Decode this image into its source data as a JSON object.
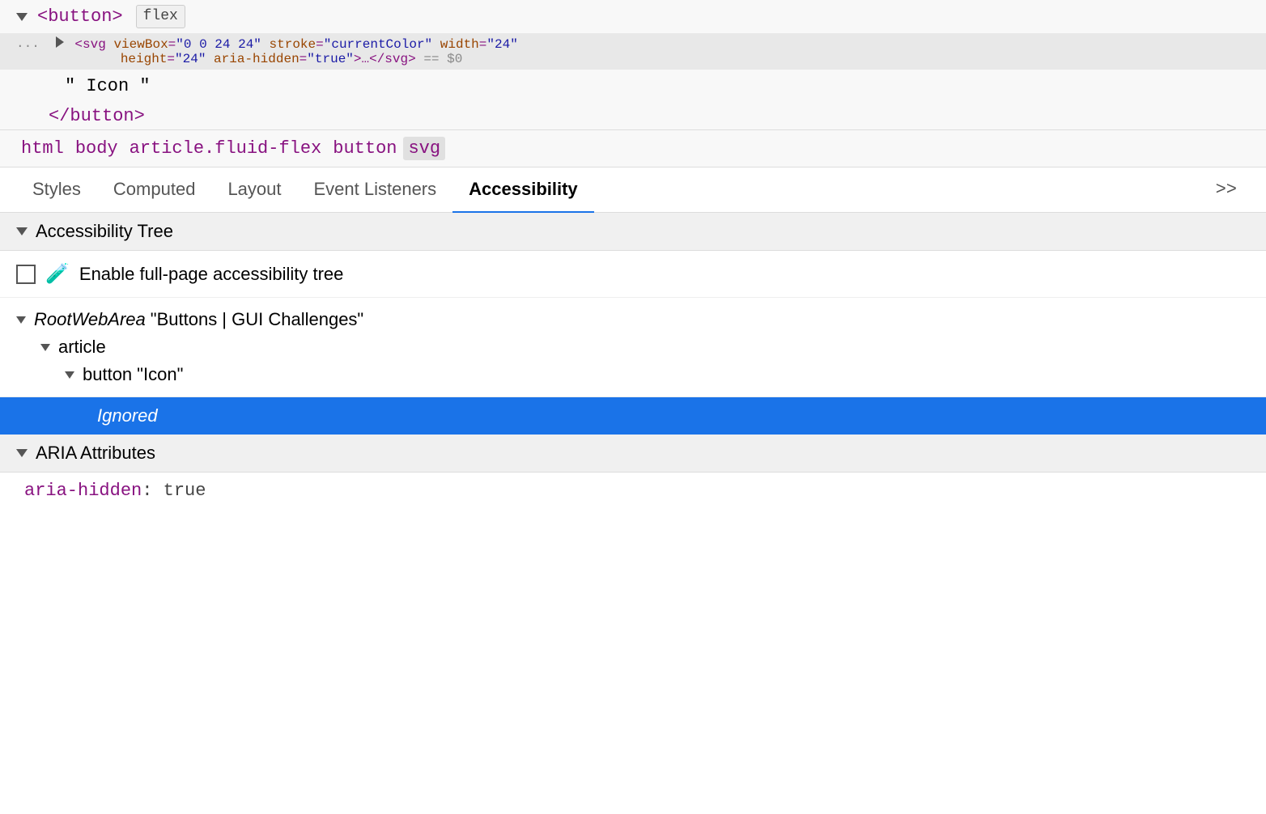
{
  "dom": {
    "button_open": "<button>",
    "flex_badge": "flex",
    "svg_dots": "...",
    "svg_line1": "<svg viewBox=\"0 0 24 24\" stroke=\"currentColor\" width=\"24\"",
    "svg_attr_viewbox_name": "viewBox",
    "svg_attr_viewbox_value": "\"0 0 24 24\"",
    "svg_attr_stroke_name": "stroke",
    "svg_attr_stroke_value": "\"currentColor\"",
    "svg_attr_width_name": "width",
    "svg_attr_width_value": "\"24\"",
    "svg_line2_attr_height_name": "height",
    "svg_line2_attr_height_value": "\"24\"",
    "svg_line2_attr_aria_name": "aria-hidden",
    "svg_line2_attr_aria_value": "\"true\"",
    "svg_line2_close": ">…</svg>",
    "svg_dollar": "== $0",
    "text_content": "\" Icon \"",
    "button_close": "</button>"
  },
  "breadcrumb": {
    "items": [
      {
        "label": "html",
        "active": false
      },
      {
        "label": "body",
        "active": false
      },
      {
        "label": "article.fluid-flex",
        "active": false
      },
      {
        "label": "button",
        "active": false
      },
      {
        "label": "svg",
        "active": true
      }
    ]
  },
  "tabs": {
    "items": [
      {
        "label": "Styles",
        "active": false
      },
      {
        "label": "Computed",
        "active": false
      },
      {
        "label": "Layout",
        "active": false
      },
      {
        "label": "Event Listeners",
        "active": false
      },
      {
        "label": "Accessibility",
        "active": true
      }
    ],
    "more_label": ">>"
  },
  "accessibility": {
    "tree_section_title": "Accessibility Tree",
    "enable_checkbox_label": "Enable full-page accessibility tree",
    "tree": {
      "root_label": "RootWebArea",
      "root_value": "\"Buttons | GUI Challenges\"",
      "article_label": "article",
      "button_label": "button",
      "button_value": "\"Icon\"",
      "ignored_label": "Ignored"
    },
    "aria_section_title": "ARIA Attributes",
    "aria_attributes": [
      {
        "name": "aria-hidden",
        "value": "true"
      }
    ]
  },
  "colors": {
    "tag_purple": "#881280",
    "attr_brown": "#994500",
    "attr_blue": "#1a1aa6",
    "active_tab_underline": "#1a73e8",
    "selected_row_bg": "#1a73e8"
  }
}
